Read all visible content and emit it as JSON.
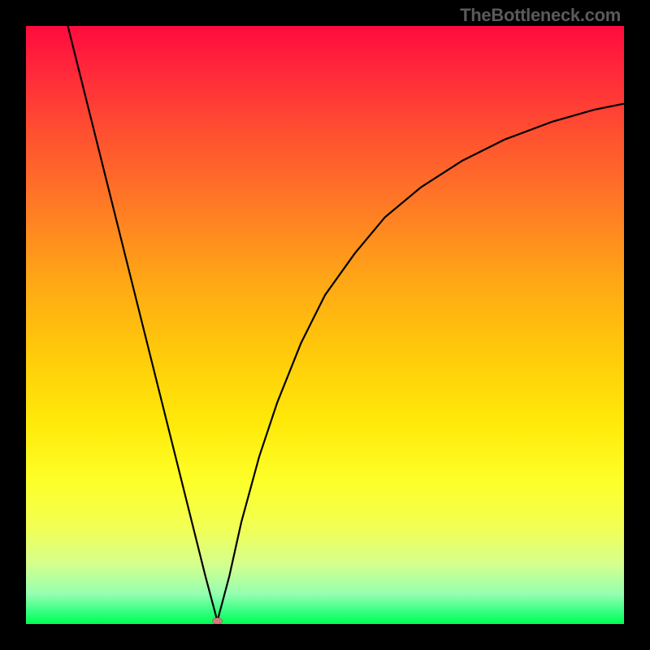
{
  "attribution": "TheBottleneck.com",
  "chart_data": {
    "type": "line",
    "title": "",
    "xlabel": "",
    "ylabel": "",
    "xlim": [
      0,
      100
    ],
    "ylim": [
      0,
      100
    ],
    "optimum_x": 32,
    "marker": {
      "x": 32,
      "y": 0.5,
      "color": "#d77a7c"
    },
    "curve_points": [
      {
        "x": 7,
        "y": 100
      },
      {
        "x": 10,
        "y": 88
      },
      {
        "x": 13,
        "y": 76
      },
      {
        "x": 16,
        "y": 64
      },
      {
        "x": 19,
        "y": 52
      },
      {
        "x": 22,
        "y": 40
      },
      {
        "x": 25,
        "y": 28
      },
      {
        "x": 28,
        "y": 16
      },
      {
        "x": 30,
        "y": 8
      },
      {
        "x": 32,
        "y": 0.5
      },
      {
        "x": 34,
        "y": 8
      },
      {
        "x": 36,
        "y": 17
      },
      {
        "x": 39,
        "y": 28
      },
      {
        "x": 42,
        "y": 37
      },
      {
        "x": 46,
        "y": 47
      },
      {
        "x": 50,
        "y": 55
      },
      {
        "x": 55,
        "y": 62
      },
      {
        "x": 60,
        "y": 68
      },
      {
        "x": 66,
        "y": 73
      },
      {
        "x": 73,
        "y": 77.5
      },
      {
        "x": 80,
        "y": 81
      },
      {
        "x": 88,
        "y": 84
      },
      {
        "x": 95,
        "y": 86
      },
      {
        "x": 100,
        "y": 87
      }
    ],
    "background_gradient": {
      "top": "#ff0b3e",
      "bottom": "#00ff50",
      "type": "heat-vertical"
    }
  }
}
